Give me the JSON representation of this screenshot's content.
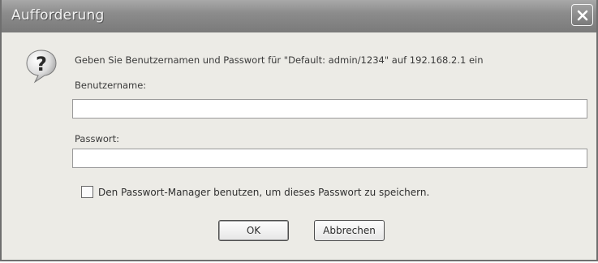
{
  "dialog": {
    "title": "Aufforderung",
    "prompt": "Geben Sie Benutzernamen und Passwort für \"Default: admin/1234\" auf 192.168.2.1 ein",
    "username_label": "Benutzername:",
    "username_value": "",
    "password_label": "Passwort:",
    "password_value": "",
    "remember_label": "Den Passwort-Manager benutzen, um dieses Passwort zu speichern.",
    "remember_checked": false,
    "ok_label": "OK",
    "cancel_label": "Abbrechen"
  },
  "icons": {
    "close": "close-icon",
    "question": "question-icon"
  },
  "colors": {
    "titlebar": "#8c8c8c",
    "background": "#ecebe6"
  }
}
